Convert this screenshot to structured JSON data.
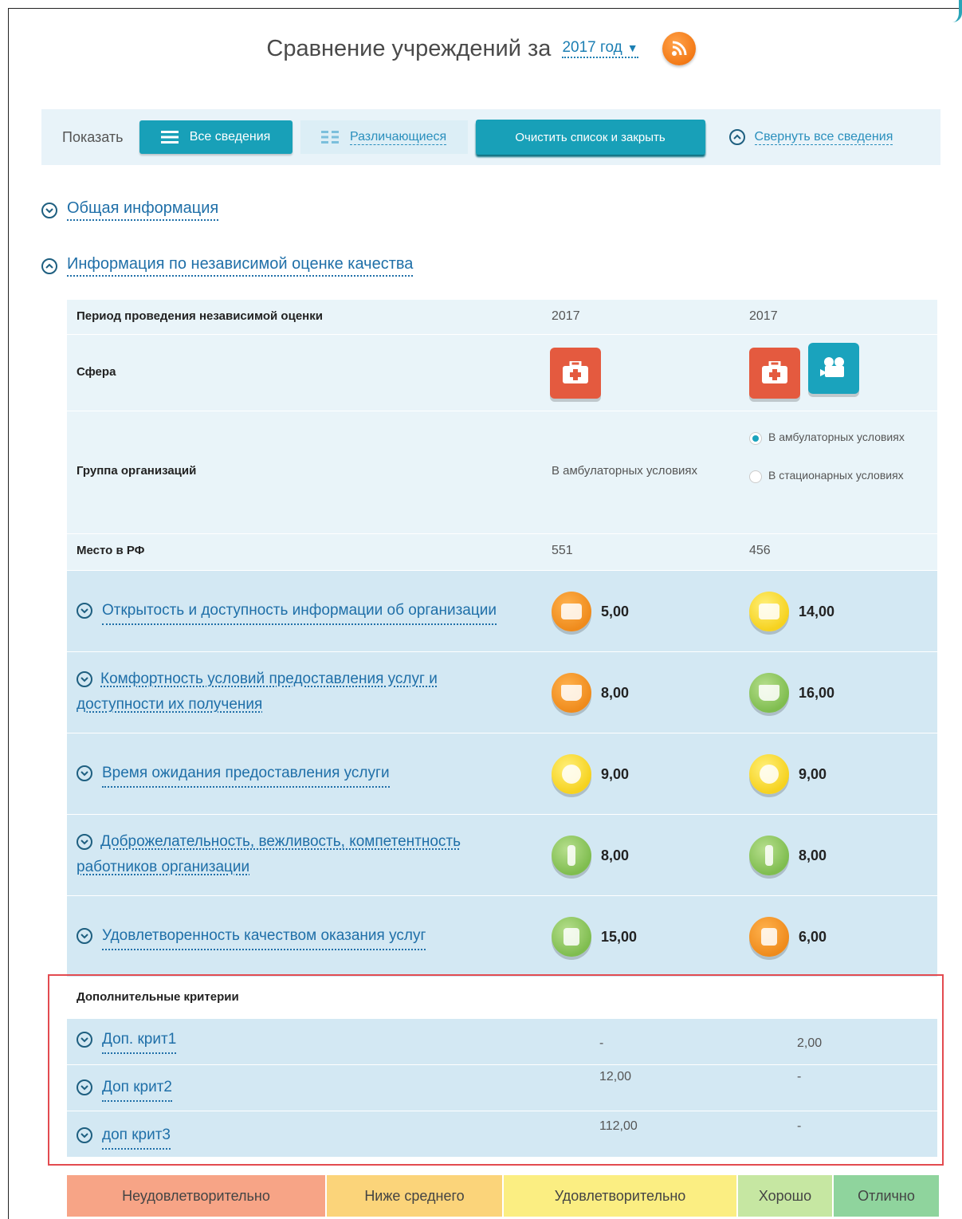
{
  "header": {
    "title": "Сравнение учреждений за",
    "year": "2017 год",
    "rss_icon": "rss-icon"
  },
  "toolbar": {
    "show_label": "Показать",
    "all_label": "Все сведения",
    "diff_label": "Различающиеся",
    "clear_label": "Очистить список и закрыть",
    "collapse_label": "Свернуть все сведения"
  },
  "sections": {
    "general": "Общая информация",
    "quality": "Информация по независимой оценке качества"
  },
  "info_rows": {
    "period": {
      "label": "Период проведения независимой оценки",
      "v1": "2017",
      "v2": "2017"
    },
    "sphere": {
      "label": "Сфера"
    },
    "group": {
      "label": "Группа организаций",
      "v1": "В амбулаторных условиях",
      "opt1": "В амбулаторных условиях",
      "opt2": "В стационарных условиях"
    },
    "place": {
      "label": "Место в РФ",
      "v1": "551",
      "v2": "456"
    }
  },
  "criteria": [
    {
      "label": "Открытость и доступность информации об организации",
      "v1": "5,00",
      "v2": "14,00"
    },
    {
      "label": "Комфортность условий предоставления услуг и доступности их получения",
      "v1": "8,00",
      "v2": "16,00"
    },
    {
      "label": "Время ожидания предоставления услуги",
      "v1": "9,00",
      "v2": "9,00"
    },
    {
      "label": "Доброжелательность, вежливость, компетентность работников организации",
      "v1": "8,00",
      "v2": "8,00"
    },
    {
      "label": "Удовлетворенность качеством оказания услуг",
      "v1": "15,00",
      "v2": "6,00"
    }
  ],
  "extra": {
    "title": "Дополнительные критерии",
    "items": [
      {
        "label": "Доп. крит1",
        "v1": "-",
        "v2": "2,00"
      },
      {
        "label": "Доп крит2",
        "v1": "12,00",
        "v2": "-"
      },
      {
        "label": "доп крит3",
        "v1": "112,00",
        "v2": "-"
      }
    ]
  },
  "legend": [
    {
      "label": "Неудовлетворительно",
      "color": "#f7a486"
    },
    {
      "label": "Ниже среднего",
      "color": "#fbd47a"
    },
    {
      "label": "Удовлетворительно",
      "color": "#fbee82"
    },
    {
      "label": "Хорошо",
      "color": "#c6e7a2"
    },
    {
      "label": "Отлично",
      "color": "#8fd49d"
    }
  ],
  "colors": {
    "accent": "#18a0b8",
    "link": "#1f6fa8",
    "highlight_border": "#e34b50"
  }
}
